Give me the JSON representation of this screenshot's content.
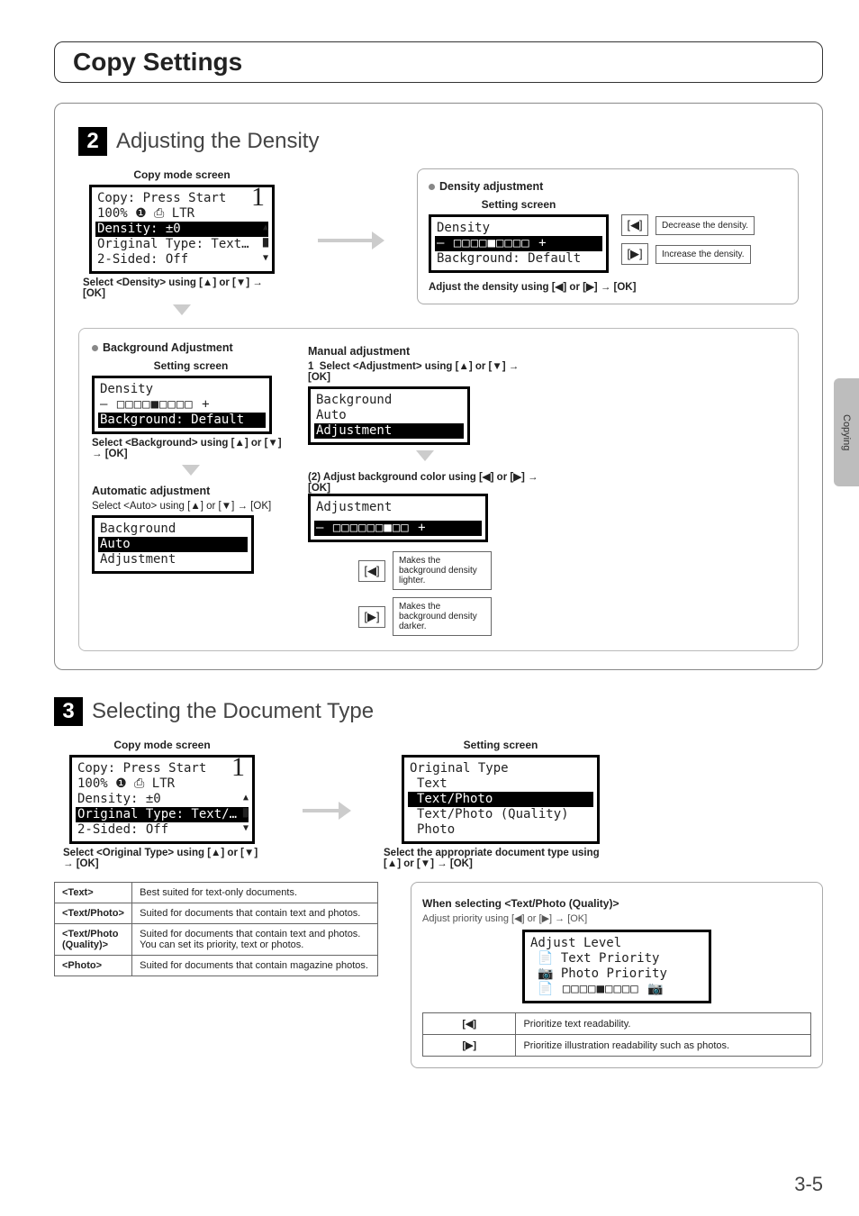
{
  "side_tab": "Copying",
  "page_title": "Copy Settings",
  "page_number": "3-5",
  "section2": {
    "num": "2",
    "title": "Adjusting the Density",
    "copy_mode_label": "Copy mode screen",
    "lcd1": {
      "l1": "Copy: Press Start",
      "l2_left": "100%",
      "l2_right": "LTR",
      "l3": "Density: ±0",
      "l4": "Original Type: Text…",
      "l5": "2-Sided: Off",
      "count": "1"
    },
    "instr1": "Select <Density> using [▲] or [▼] → [OK]",
    "density_adj": {
      "title": "Density adjustment",
      "setting_label": "Setting screen",
      "lcd": {
        "l1": "Density",
        "l2": "– □□□□■□□□□ +",
        "l3": "Background: Default"
      },
      "dec": "Decrease the density.",
      "inc": "Increase the density.",
      "instr": "Adjust the density using [◀] or [▶] → [OK]"
    },
    "bg_adj": {
      "title": "Background Adjustment",
      "setting_label": "Setting screen",
      "lcd": {
        "l1": "Density",
        "l2": "– □□□□■□□□□ +",
        "l3": "Background: Default"
      },
      "instr": "Select <Background> using [▲] or [▼] → [OK]",
      "auto_title": "Automatic adjustment",
      "auto_instr": "Select <Auto> using [▲] or [▼] → [OK]",
      "auto_lcd": {
        "l1": "Background",
        "l2": "Auto",
        "l3": "Adjustment"
      },
      "manual_title": "Manual adjustment",
      "man_step1": "Select <Adjustment> using [▲] or [▼] → [OK]",
      "man_lcd1": {
        "l1": "Background",
        "l2": "Auto",
        "l3": "Adjustment"
      },
      "man_step2_label": "(2) Adjust background color using [◀] or [▶] → [OK]",
      "man_lcd2": {
        "l1": "Adjustment",
        "l2": "– □□□□□□■□□ +"
      },
      "left_tip": "Makes the background density lighter.",
      "right_tip": "Makes the background density darker."
    }
  },
  "section3": {
    "num": "3",
    "title": "Selecting the Document Type",
    "copy_mode_label": "Copy mode screen",
    "lcd1": {
      "l1": "Copy: Press Start",
      "l2_left": "100%",
      "l2_right": "LTR",
      "l3": "Density: ±0",
      "l4": "Original Type: Text/…",
      "l5": "2-Sided: Off",
      "count": "1"
    },
    "instr1": "Select <Original Type> using [▲] or [▼] → [OK]",
    "setting_label": "Setting screen",
    "lcd2": {
      "l1": "Original Type",
      "l2": "Text",
      "l3": "Text/Photo",
      "l4": "Text/Photo (Quality)",
      "l5": "Photo"
    },
    "instr2": "Select the appropriate document type using [▲] or [▼] → [OK]",
    "table": {
      "r1h": "<Text>",
      "r1d": "Best suited for text-only documents.",
      "r2h": "<Text/Photo>",
      "r2d": "Suited for documents that contain text and photos.",
      "r3h": "<Text/Photo (Quality)>",
      "r3d": "Suited for documents that contain text and photos. You can set its priority, text or photos.",
      "r4h": "<Photo>",
      "r4d": "Suited for documents that contain magazine photos."
    },
    "quality_box": {
      "title": "When selecting <Text/Photo (Quality)>",
      "instr": "Adjust priority using [◀] or [▶] → [OK]",
      "lcd": {
        "l1": "Adjust Level",
        "l2": "Text Priority",
        "l3": "Photo Priority",
        "l4": "□□□□■□□□□"
      },
      "left": "Prioritize text readability.",
      "right": "Prioritize illustration readability such as photos."
    }
  }
}
